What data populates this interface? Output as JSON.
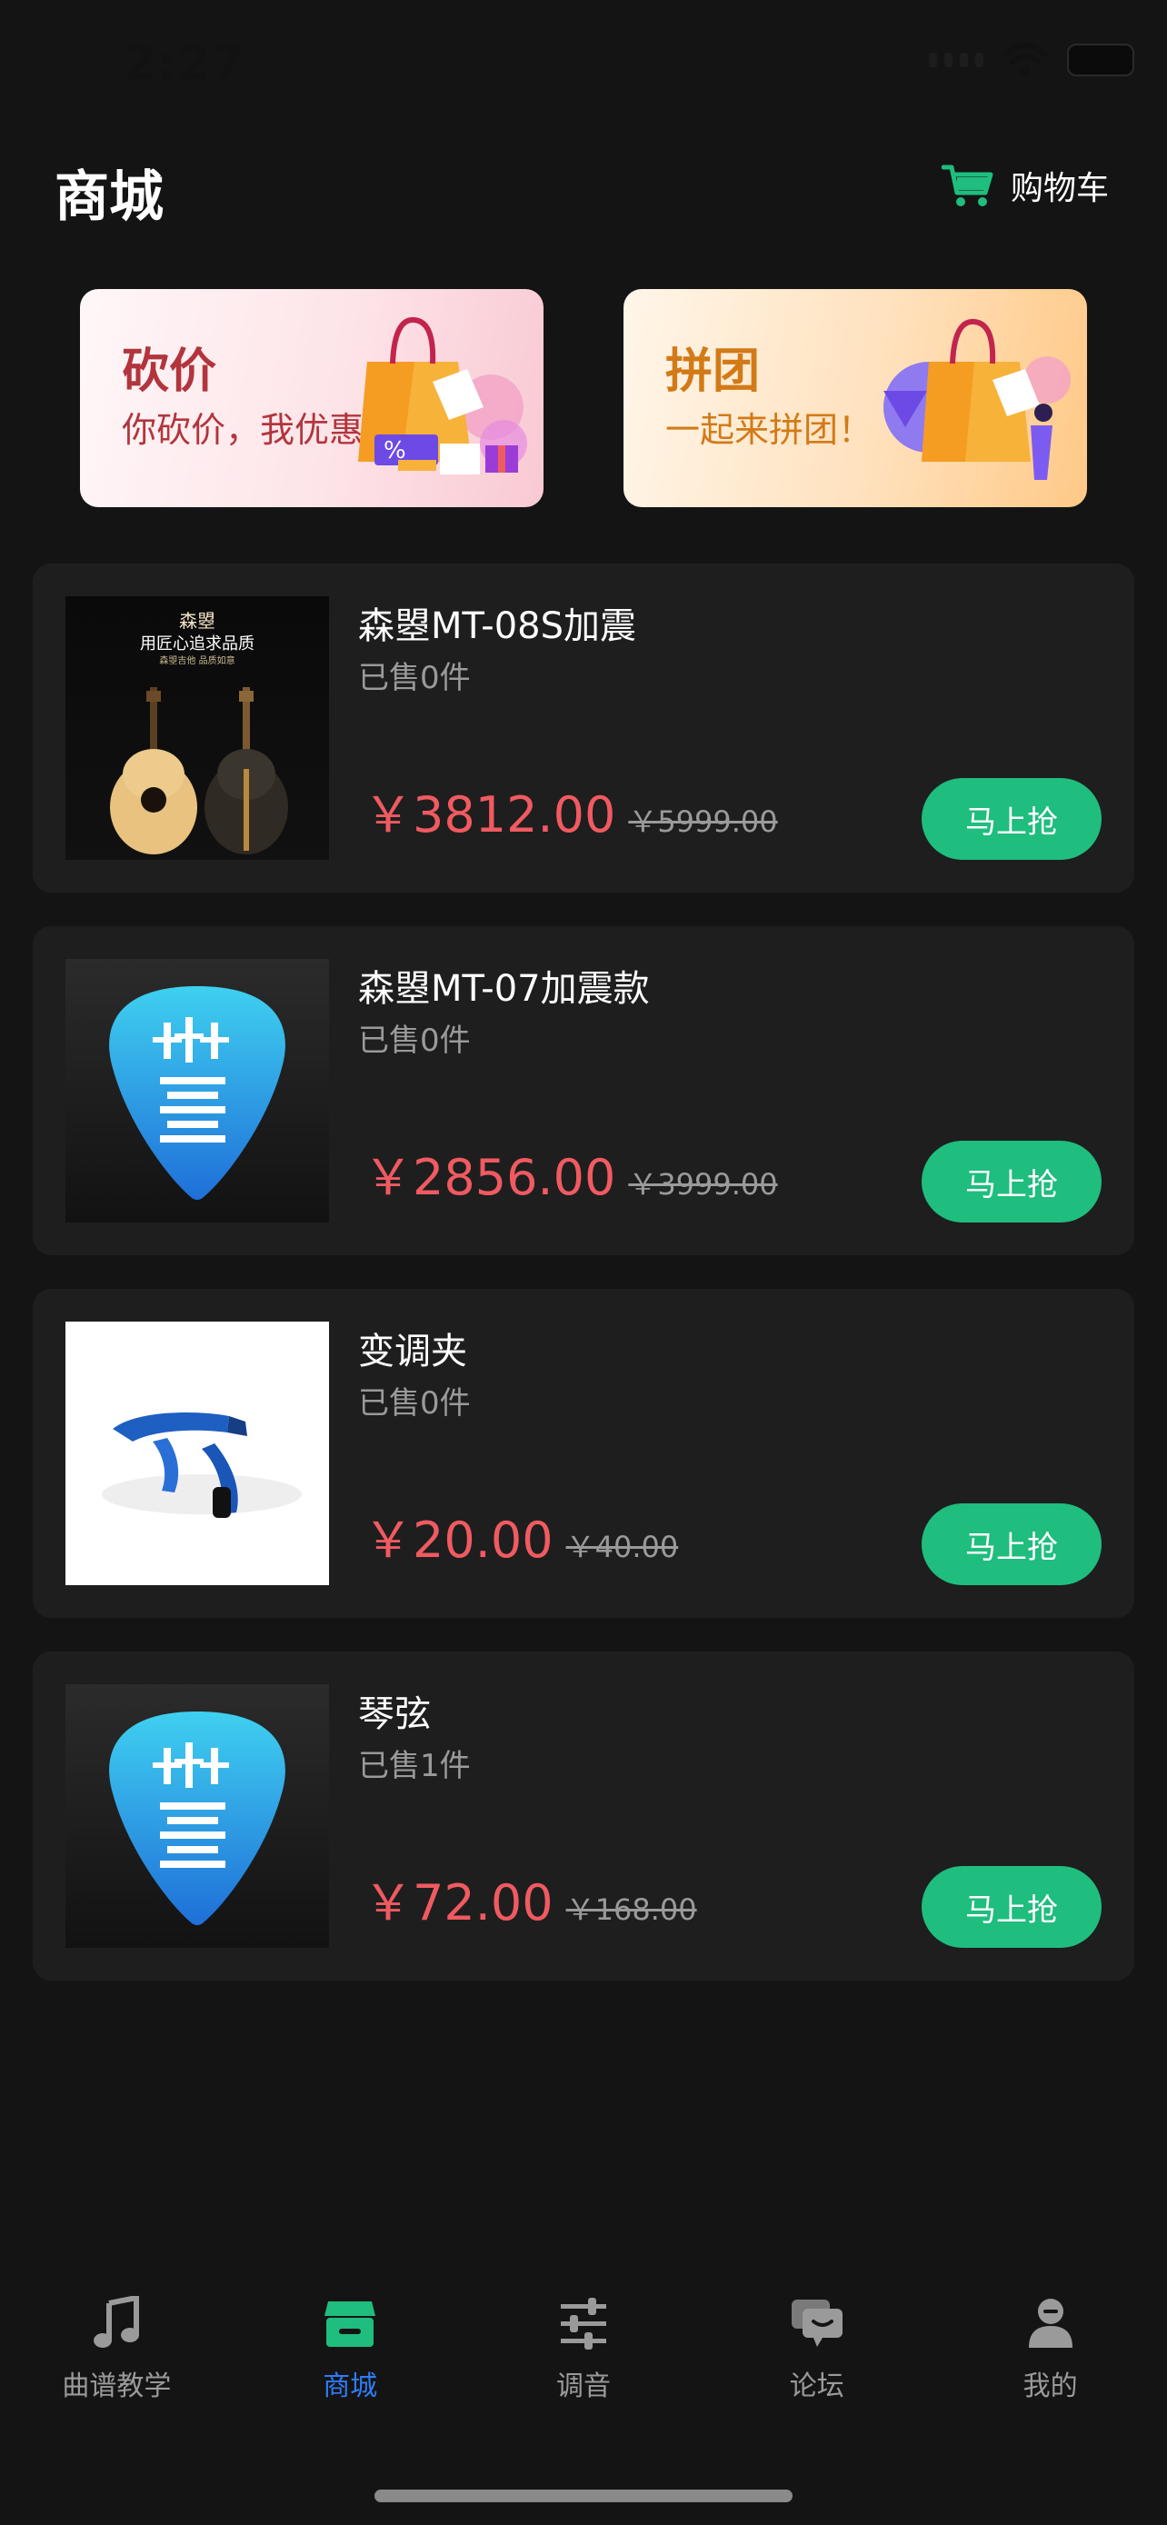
{
  "status_bar": {
    "time": "2:27"
  },
  "header": {
    "title": "商城",
    "cart_label": "购物车",
    "cart_icon": "shopping-cart-icon",
    "accent": "#1fbd7e"
  },
  "promos": [
    {
      "title": "砍价",
      "subtitle": "你砍价，我优惠"
    },
    {
      "title": "拼团",
      "subtitle": "一起来拼团！"
    }
  ],
  "products": [
    {
      "name": "森曌MT-08S加震",
      "sold": "已售0件",
      "price": "￥3812.00",
      "original_price": "￥5999.00",
      "button": "马上抢",
      "thumb_text_1": "森曌",
      "thumb_text_2": "用匠心追求品质",
      "thumb_text_3": "森曌吉他 品质如意"
    },
    {
      "name": "森曌MT-07加震款",
      "sold": "已售0件",
      "price": "￥2856.00",
      "original_price": "￥3999.00",
      "button": "马上抢"
    },
    {
      "name": "变调夹",
      "sold": "已售0件",
      "price": "￥20.00",
      "original_price": "￥40.00",
      "button": "马上抢"
    },
    {
      "name": "琴弦",
      "sold": "已售1件",
      "price": "￥72.00",
      "original_price": "￥168.00",
      "button": "马上抢"
    }
  ],
  "tabs": [
    {
      "label": "曲谱教学",
      "icon": "music-note-icon",
      "active": false
    },
    {
      "label": "商城",
      "icon": "store-icon",
      "active": true
    },
    {
      "label": "调音",
      "icon": "sliders-icon",
      "active": false
    },
    {
      "label": "论坛",
      "icon": "chat-bubbles-icon",
      "active": false
    },
    {
      "label": "我的",
      "icon": "user-icon",
      "active": false
    }
  ],
  "colors": {
    "background": "#141414",
    "card": "#1e1e1e",
    "price": "#f05a61",
    "buy_button": "#1fbd7e",
    "active_tab": "#2f7cf6",
    "inactive_tab": "#9a9a9a"
  }
}
